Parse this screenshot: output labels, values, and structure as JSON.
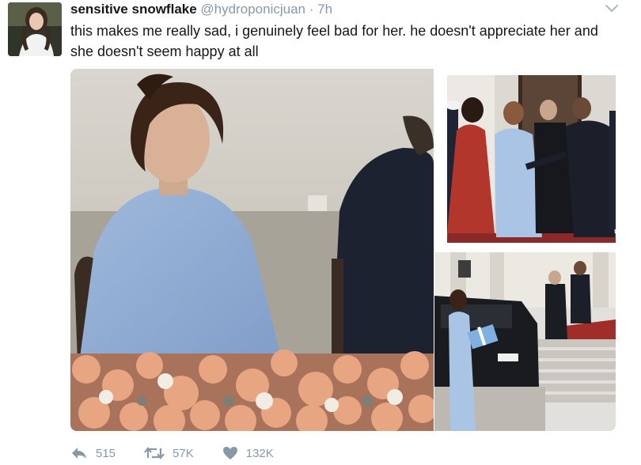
{
  "tweet": {
    "display_name": "sensitive snowflake",
    "handle": "@hydroponicjuan",
    "separator": "·",
    "time": "7h",
    "text": "this makes me really sad, i genuinely feel bad for her. he doesn't appreciate her and she doesn't seem happy at all"
  },
  "actions": {
    "reply_count": "515",
    "retweet_count": "57K",
    "like_count": "132K"
  },
  "icons": {
    "avatar": "avatar-icon",
    "more": "chevron-down-icon",
    "reply": "reply-icon",
    "retweet": "retweet-icon",
    "like": "heart-icon"
  },
  "colors": {
    "text": "#14171a",
    "muted": "#8899a6"
  }
}
